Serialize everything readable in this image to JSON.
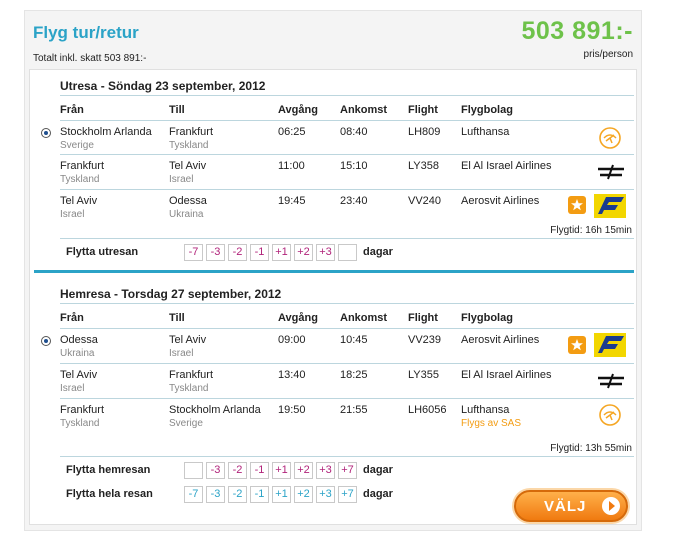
{
  "header": {
    "title": "Flyg tur/retur",
    "total_label": "Totalt inkl. skatt  503 891:-",
    "price": "503 891:-",
    "per_person": "pris/person"
  },
  "columns": {
    "from": "Från",
    "to": "Till",
    "depart": "Avgång",
    "arrive": "Ankomst",
    "flight": "Flight",
    "airline": "Flygbolag"
  },
  "outbound": {
    "title": "Utresa - Söndag 23 september, 2012",
    "legs": [
      {
        "from": "Stockholm Arlanda",
        "from_country": "Sverige",
        "to": "Frankfurt",
        "to_country": "Tyskland",
        "depart": "06:25",
        "arrive": "08:40",
        "flight": "LH809",
        "airline": "Lufthansa",
        "logo": "lufthansa-crane-icon"
      },
      {
        "from": "Frankfurt",
        "from_country": "Tyskland",
        "to": "Tel Aviv",
        "to_country": "Israel",
        "depart": "11:00",
        "arrive": "15:10",
        "flight": "LY358",
        "airline": "El Al Israel Airlines",
        "logo": "elal-icon"
      },
      {
        "from": "Tel Aviv",
        "from_country": "Israel",
        "to": "Odessa",
        "to_country": "Ukraina",
        "depart": "19:45",
        "arrive": "23:40",
        "flight": "VV240",
        "airline": "Aerosvit Airlines",
        "logo": "aerosvit-icon"
      }
    ],
    "flight_time": "Flygtid: 16h 15min",
    "move_label": "Flytta utresan",
    "chips": [
      "-7",
      "-3",
      "-2",
      "-1",
      "+1",
      "+2",
      "+3",
      ""
    ],
    "dagar": "dagar"
  },
  "inbound": {
    "title": "Hemresa - Torsdag 27 september, 2012",
    "legs": [
      {
        "from": "Odessa",
        "from_country": "Ukraina",
        "to": "Tel Aviv",
        "to_country": "Israel",
        "depart": "09:00",
        "arrive": "10:45",
        "flight": "VV239",
        "airline": "Aerosvit Airlines",
        "logo": "aerosvit-icon"
      },
      {
        "from": "Tel Aviv",
        "from_country": "Israel",
        "to": "Frankfurt",
        "to_country": "Tyskland",
        "depart": "13:40",
        "arrive": "18:25",
        "flight": "LY355",
        "airline": "El Al Israel Airlines",
        "logo": "elal-icon"
      },
      {
        "from": "Frankfurt",
        "from_country": "Tyskland",
        "to": "Stockholm Arlanda",
        "to_country": "Sverige",
        "depart": "19:50",
        "arrive": "21:55",
        "flight": "LH6056",
        "airline": "Lufthansa",
        "operated_by": "Flygs av SAS",
        "logo": "lufthansa-crane-icon"
      }
    ],
    "flight_time": "Flygtid: 13h 55min",
    "move_label": "Flytta hemresan",
    "chips": [
      "",
      "-3",
      "-2",
      "-1",
      "+1",
      "+2",
      "+3",
      "+7"
    ],
    "dagar": "dagar",
    "move_all_label": "Flytta hela resan",
    "chips_all": [
      "-7",
      "-3",
      "-2",
      "-1",
      "+1",
      "+2",
      "+3",
      "+7"
    ],
    "dagar_all": "dagar"
  },
  "select_button": "VÄLJ",
  "colors": {
    "accent": "#2ba3c7",
    "price": "#6ec24a",
    "chip_pink": "#b1237a",
    "button": "#f07a10"
  }
}
